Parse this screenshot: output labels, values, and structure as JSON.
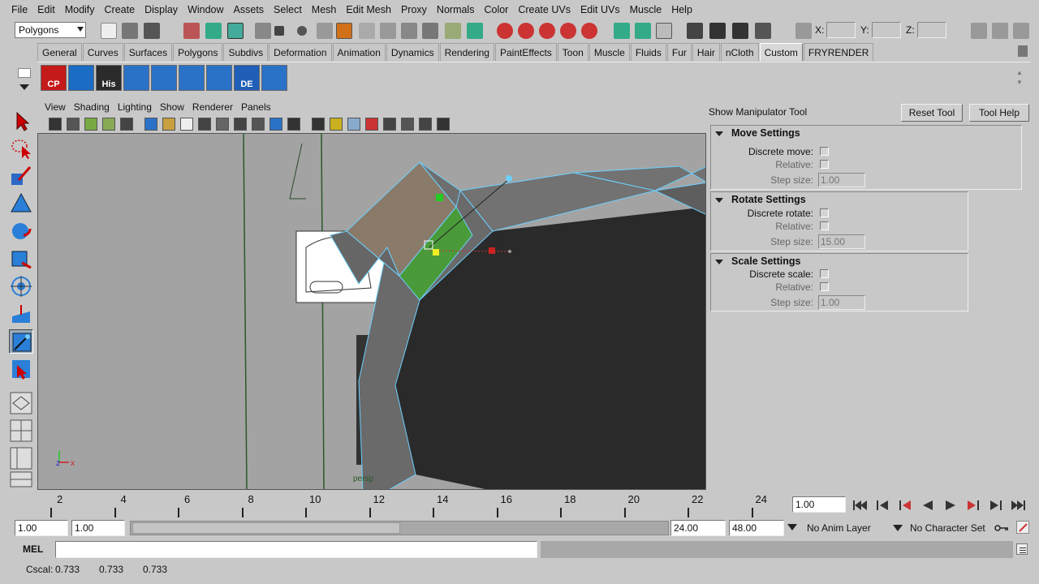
{
  "menubar": [
    "File",
    "Edit",
    "Modify",
    "Create",
    "Display",
    "Window",
    "Assets",
    "Select",
    "Mesh",
    "Edit Mesh",
    "Proxy",
    "Normals",
    "Color",
    "Create UVs",
    "Edit UVs",
    "Muscle",
    "Help"
  ],
  "status": {
    "mode": "Polygons",
    "x_label": "X:",
    "y_label": "Y:",
    "z_label": "Z:"
  },
  "shelf_tabs": [
    "General",
    "Curves",
    "Surfaces",
    "Polygons",
    "Subdivs",
    "Deformation",
    "Animation",
    "Dynamics",
    "Rendering",
    "PaintEffects",
    "Toon",
    "Muscle",
    "Fluids",
    "Fur",
    "Hair",
    "nCloth",
    "Custom",
    "FRYRENDER"
  ],
  "shelf_active": "Custom",
  "shelf_buttons": [
    {
      "label": "CP",
      "color": "#c41a1a"
    },
    {
      "label": "",
      "color": "#1a6cc4"
    },
    {
      "label": "His",
      "color": "#2b2b2b"
    },
    {
      "label": "",
      "color": "#2a72c8"
    },
    {
      "label": "",
      "color": "#2a72c8"
    },
    {
      "label": "",
      "color": "#2a72c8"
    },
    {
      "label": "",
      "color": "#2a72c8"
    },
    {
      "label": "DE",
      "color": "#1f5fb8"
    },
    {
      "label": "",
      "color": "#2a72c8"
    }
  ],
  "panel_menu": [
    "View",
    "Shading",
    "Lighting",
    "Show",
    "Renderer",
    "Panels"
  ],
  "tool_settings": {
    "title": "Show Manipulator Tool",
    "reset": "Reset Tool",
    "help": "Tool Help",
    "move": {
      "title": "Move Settings",
      "discrete": "Discrete move:",
      "relative": "Relative:",
      "step_label": "Step size:",
      "step": "1.00"
    },
    "rotate": {
      "title": "Rotate Settings",
      "discrete": "Discrete rotate:",
      "relative": "Relative:",
      "step_label": "Step size:",
      "step": "15.00"
    },
    "scale": {
      "title": "Scale Settings",
      "discrete": "Discrete scale:",
      "relative": "Relative:",
      "step_label": "Step size:",
      "step": "1.00"
    }
  },
  "viewport": {
    "camera_label": "persp"
  },
  "time_ticks": [
    "2",
    "4",
    "6",
    "8",
    "10",
    "12",
    "14",
    "16",
    "18",
    "20",
    "22",
    "24"
  ],
  "current_time": "1.00",
  "range": {
    "start": "1.00",
    "start2": "1.00",
    "end": "24.00",
    "end2": "48.00",
    "anim_layer": "No Anim Layer",
    "char_set": "No Character Set"
  },
  "cmd": {
    "label": "MEL"
  },
  "help_line": {
    "label": "Cscal:",
    "v1": "0.733",
    "v2": "0.733",
    "v3": "0.733"
  }
}
